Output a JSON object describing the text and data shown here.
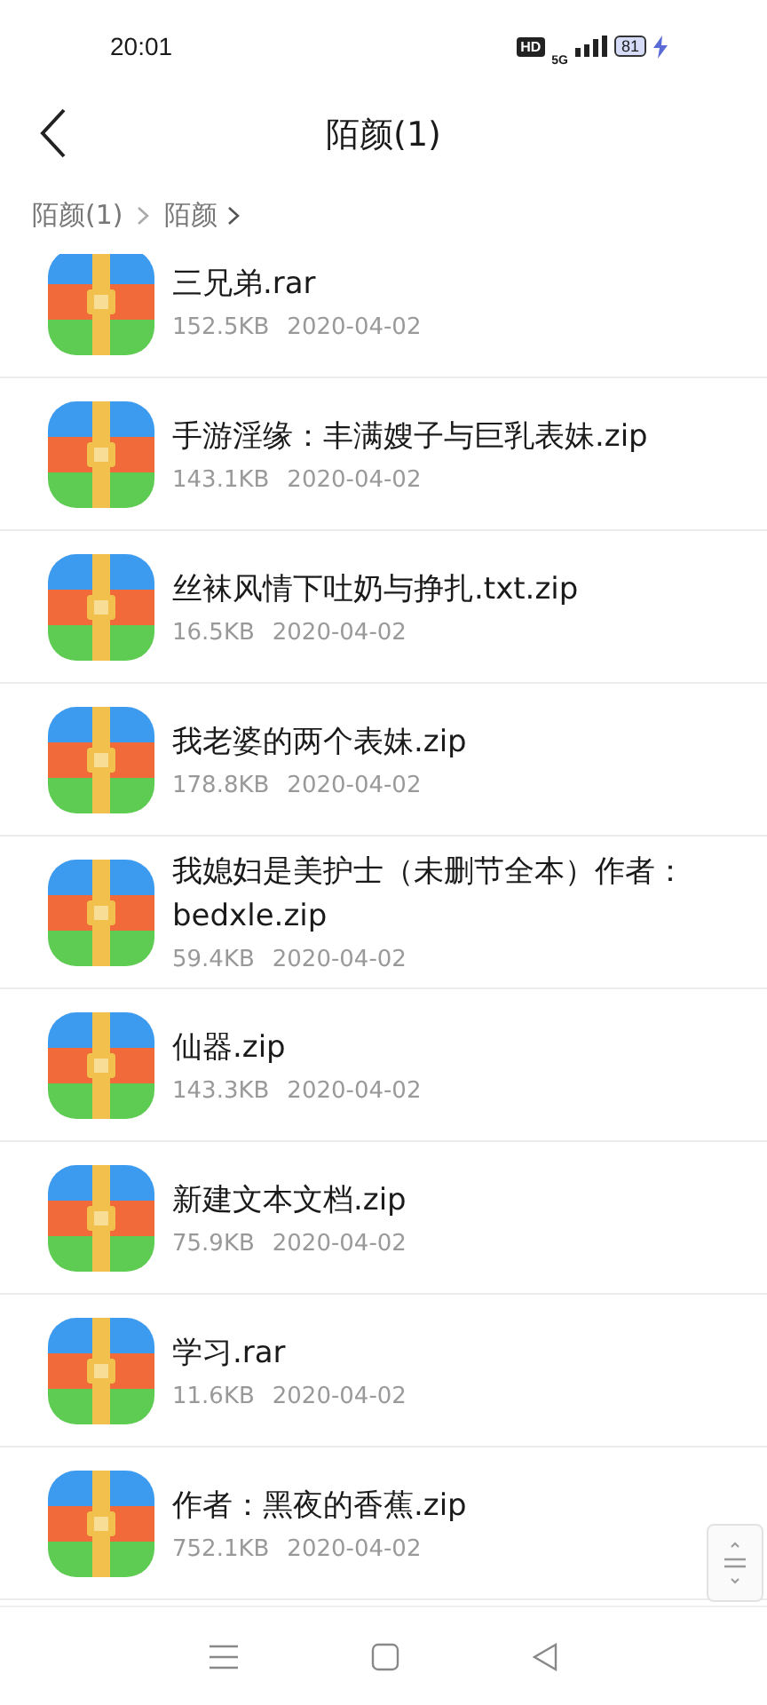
{
  "status_bar": {
    "time": "20:01",
    "hd": "HD",
    "network": "5G",
    "battery": "81",
    "charging": true
  },
  "header": {
    "title": "陌颜(1)"
  },
  "breadcrumb": [
    "陌颜(1)",
    "陌颜"
  ],
  "files": [
    {
      "name": "三兄弟.rar",
      "size": "152.5KB",
      "date": "2020-04-02"
    },
    {
      "name": "手游淫缘：丰满嫂子与巨乳表妹.zip",
      "size": "143.1KB",
      "date": "2020-04-02"
    },
    {
      "name": "丝袜风情下吐奶与挣扎.txt.zip",
      "size": "16.5KB",
      "date": "2020-04-02"
    },
    {
      "name": "我老婆的两个表妹.zip",
      "size": "178.8KB",
      "date": "2020-04-02"
    },
    {
      "name": "我媳妇是美护士（未删节全本）作者：bedxle.zip",
      "size": "59.4KB",
      "date": "2020-04-02"
    },
    {
      "name": "仙器.zip",
      "size": "143.3KB",
      "date": "2020-04-02"
    },
    {
      "name": "新建文本文档.zip",
      "size": "75.9KB",
      "date": "2020-04-02"
    },
    {
      "name": "学习.rar",
      "size": "11.6KB",
      "date": "2020-04-02"
    },
    {
      "name": "作者：黑夜的香蕉.zip",
      "size": "752.1KB",
      "date": "2020-04-02"
    }
  ]
}
